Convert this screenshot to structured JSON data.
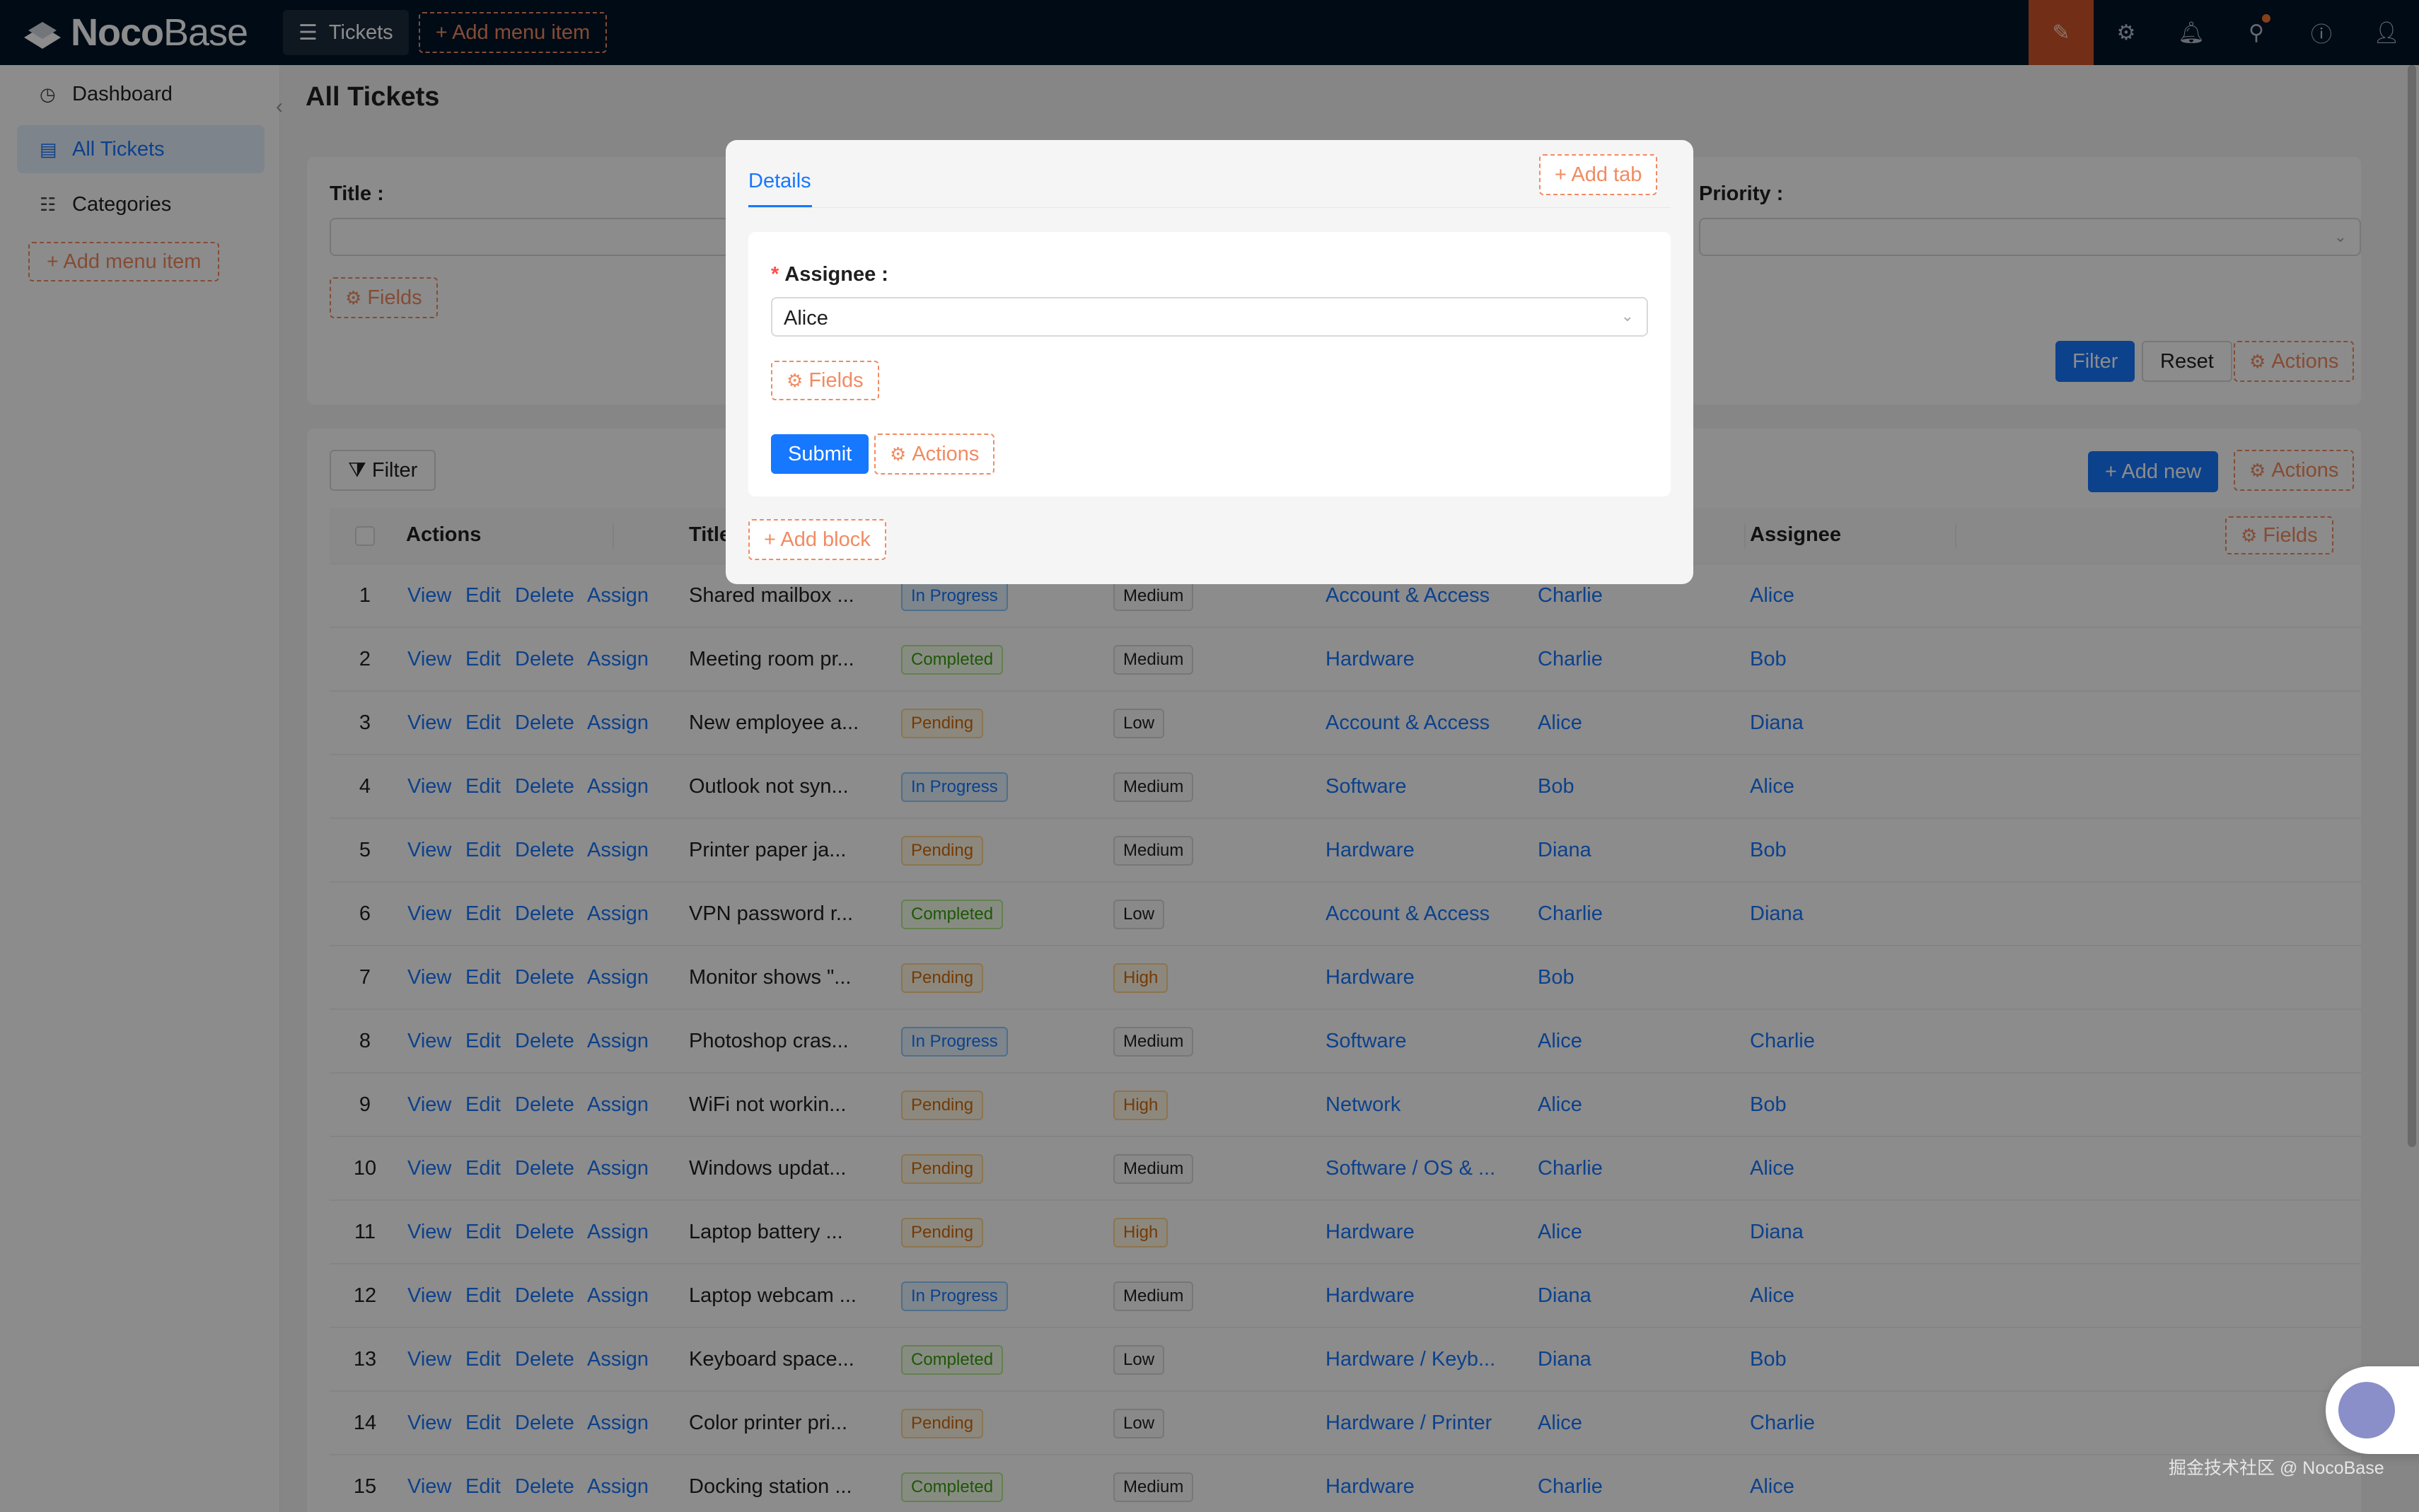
{
  "app": {
    "logo_bold": "Noco",
    "logo_light": "Base"
  },
  "topbar": {
    "menu_label": "Tickets",
    "add_menu_label": "+ Add menu item"
  },
  "sidebar": {
    "items": [
      {
        "label": "Dashboard",
        "icon": "dashboard-icon"
      },
      {
        "label": "All Tickets",
        "icon": "file-icon"
      },
      {
        "label": "Categories",
        "icon": "list-icon"
      }
    ],
    "add_label": "+ Add menu item"
  },
  "page": {
    "title": "All Tickets"
  },
  "filter_form": {
    "title_label": "Title :",
    "priority_label": "Priority :",
    "fields_label": "Fields",
    "filter_label": "Filter",
    "reset_label": "Reset",
    "actions_label": "Actions"
  },
  "table_toolbar": {
    "filter_label": "Filter",
    "add_new_label": "+ Add new",
    "actions_label": "Actions",
    "fields_label": "Fields"
  },
  "table": {
    "headers": {
      "actions": "Actions",
      "title": "Title",
      "assignee": "Assignee"
    },
    "row_actions": [
      "View",
      "Edit",
      "Delete",
      "Assign"
    ],
    "rows": [
      {
        "no": "1",
        "title": "Shared mailbox ...",
        "status": "In Progress",
        "priority": "Medium",
        "category": "Account & Access",
        "reporter": "Charlie",
        "assignee": "Alice"
      },
      {
        "no": "2",
        "title": "Meeting room pr...",
        "status": "Completed",
        "priority": "Medium",
        "category": "Hardware",
        "reporter": "Charlie",
        "assignee": "Bob"
      },
      {
        "no": "3",
        "title": "New employee a...",
        "status": "Pending",
        "priority": "Low",
        "category": "Account & Access",
        "reporter": "Alice",
        "assignee": "Diana"
      },
      {
        "no": "4",
        "title": "Outlook not syn...",
        "status": "In Progress",
        "priority": "Medium",
        "category": "Software",
        "reporter": "Bob",
        "assignee": "Alice"
      },
      {
        "no": "5",
        "title": "Printer paper ja...",
        "status": "Pending",
        "priority": "Medium",
        "category": "Hardware",
        "reporter": "Diana",
        "assignee": "Bob"
      },
      {
        "no": "6",
        "title": "VPN password r...",
        "status": "Completed",
        "priority": "Low",
        "category": "Account & Access",
        "reporter": "Charlie",
        "assignee": "Diana"
      },
      {
        "no": "7",
        "title": "Monitor shows \"...",
        "status": "Pending",
        "priority": "High",
        "category": "Hardware",
        "reporter": "Bob",
        "assignee": ""
      },
      {
        "no": "8",
        "title": "Photoshop cras...",
        "status": "In Progress",
        "priority": "Medium",
        "category": "Software",
        "reporter": "Alice",
        "assignee": "Charlie"
      },
      {
        "no": "9",
        "title": "WiFi not workin...",
        "status": "Pending",
        "priority": "High",
        "category": "Network",
        "reporter": "Alice",
        "assignee": "Bob"
      },
      {
        "no": "10",
        "title": "Windows updat...",
        "status": "Pending",
        "priority": "Medium",
        "category": "Software / OS & ...",
        "reporter": "Charlie",
        "assignee": "Alice"
      },
      {
        "no": "11",
        "title": "Laptop battery ...",
        "status": "Pending",
        "priority": "High",
        "category": "Hardware",
        "reporter": "Alice",
        "assignee": "Diana"
      },
      {
        "no": "12",
        "title": "Laptop webcam ...",
        "status": "In Progress",
        "priority": "Medium",
        "category": "Hardware",
        "reporter": "Diana",
        "assignee": "Alice"
      },
      {
        "no": "13",
        "title": "Keyboard space...",
        "status": "Completed",
        "priority": "Low",
        "category": "Hardware / Keyb...",
        "reporter": "Diana",
        "assignee": "Bob"
      },
      {
        "no": "14",
        "title": "Color printer pri...",
        "status": "Pending",
        "priority": "Low",
        "category": "Hardware / Printer",
        "reporter": "Alice",
        "assignee": "Charlie"
      },
      {
        "no": "15",
        "title": "Docking station ...",
        "status": "Completed",
        "priority": "Medium",
        "category": "Hardware",
        "reporter": "Charlie",
        "assignee": "Alice"
      }
    ]
  },
  "modal": {
    "tab_label": "Details",
    "add_tab_label": "+ Add tab",
    "assignee_label": "Assignee :",
    "required_mark": "*",
    "assignee_value": "Alice",
    "fields_label": "Fields",
    "submit_label": "Submit",
    "actions_label": "Actions",
    "add_block_label": "+ Add block"
  },
  "watermark": "掘金技术社区 @ NocoBase",
  "colors": {
    "primary": "#1677ff",
    "dashed_accent": "#f18b62",
    "topbar_bg": "#001529",
    "active_top_icon": "#d0552b"
  }
}
